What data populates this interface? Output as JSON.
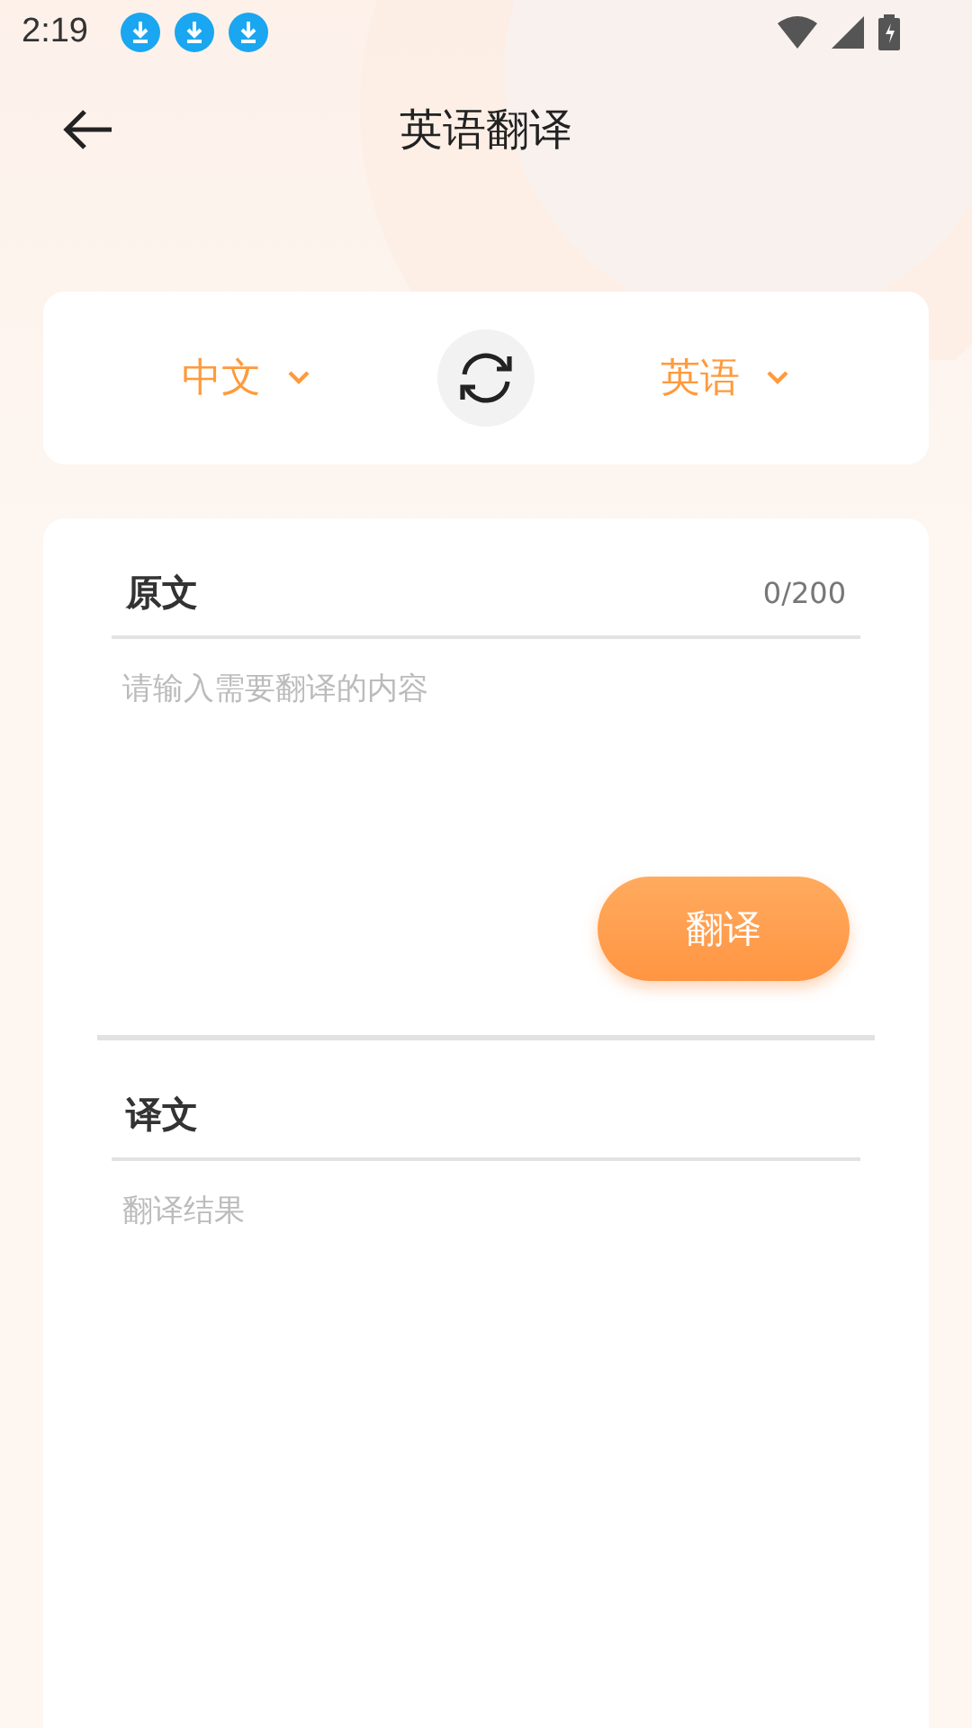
{
  "status_bar": {
    "time": "2:19"
  },
  "header": {
    "title": "英语翻译"
  },
  "languages": {
    "source": "中文",
    "target": "英语"
  },
  "source_panel": {
    "label": "原文",
    "counter": "0/200",
    "placeholder": "请输入需要翻译的内容"
  },
  "translate_button": "翻译",
  "result_panel": {
    "label": "译文",
    "placeholder": "翻译结果"
  }
}
